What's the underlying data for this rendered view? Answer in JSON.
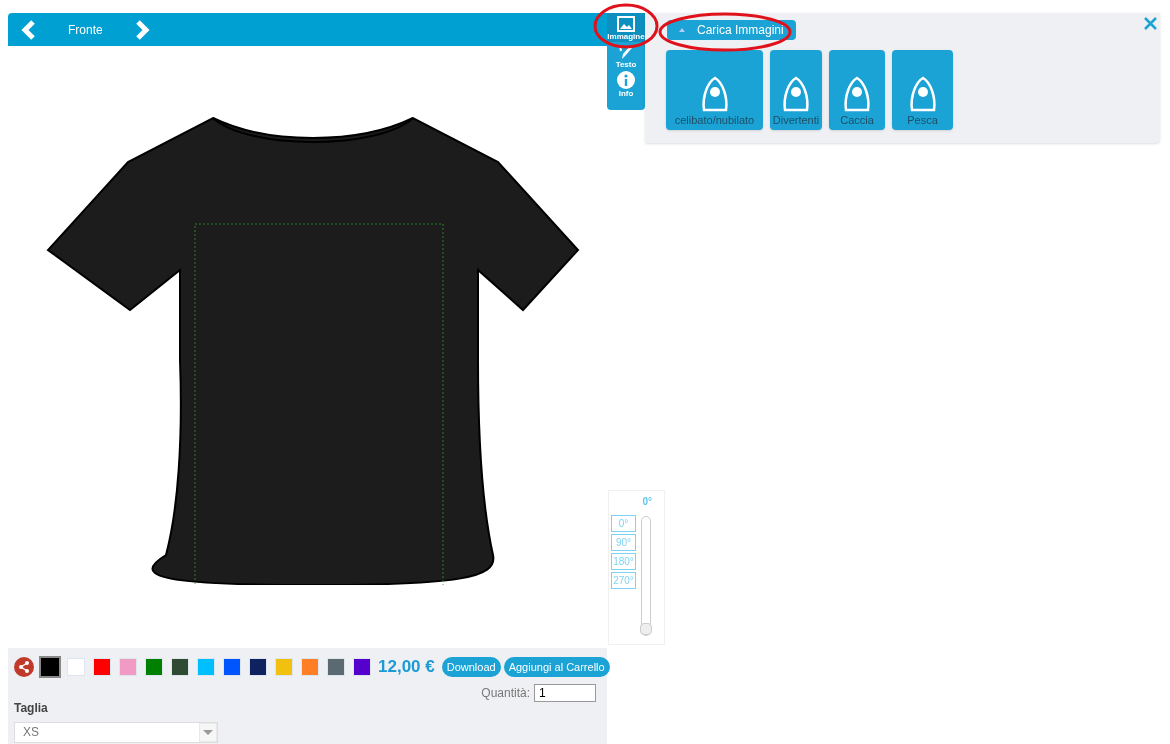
{
  "view_bar": {
    "label": "Fronte"
  },
  "side_tabs": [
    {
      "label": "Immagine",
      "kind": "image",
      "selected": true
    },
    {
      "label": "Testo",
      "kind": "text",
      "selected": false
    },
    {
      "label": "Info",
      "kind": "info",
      "selected": false
    }
  ],
  "panel": {
    "upload_button": "Carica Immagini",
    "categories": [
      {
        "label": "celibato/nubilato"
      },
      {
        "label": "Divertenti"
      },
      {
        "label": "Caccia"
      },
      {
        "label": "Pesca"
      }
    ]
  },
  "rotation": {
    "reading": "0°",
    "presets": [
      "0°",
      "90°",
      "180°",
      "270°"
    ],
    "level": 0
  },
  "colors": [
    {
      "color": "#000000",
      "selected": true
    },
    {
      "color": "#ffffff",
      "selected": false
    },
    {
      "color": "#ff0000",
      "selected": false
    },
    {
      "color": "#f09ac4",
      "selected": false
    },
    {
      "color": "#008000",
      "selected": false
    },
    {
      "color": "#2f4a33",
      "selected": false
    },
    {
      "color": "#00bfff",
      "selected": false
    },
    {
      "color": "#0055ff",
      "selected": false
    },
    {
      "color": "#0f2260",
      "selected": false
    },
    {
      "color": "#f2c10f",
      "selected": false
    },
    {
      "color": "#ff7f27",
      "selected": false
    },
    {
      "color": "#5a6a70",
      "selected": false
    },
    {
      "color": "#5500cc",
      "selected": false
    }
  ],
  "price": "12,00 €",
  "buttons": [
    "Download",
    "Aggiungi al Carrello"
  ],
  "quantity": {
    "label": "Quantità:",
    "value": "1"
  },
  "size": {
    "label": "Taglia",
    "value": "XS"
  }
}
